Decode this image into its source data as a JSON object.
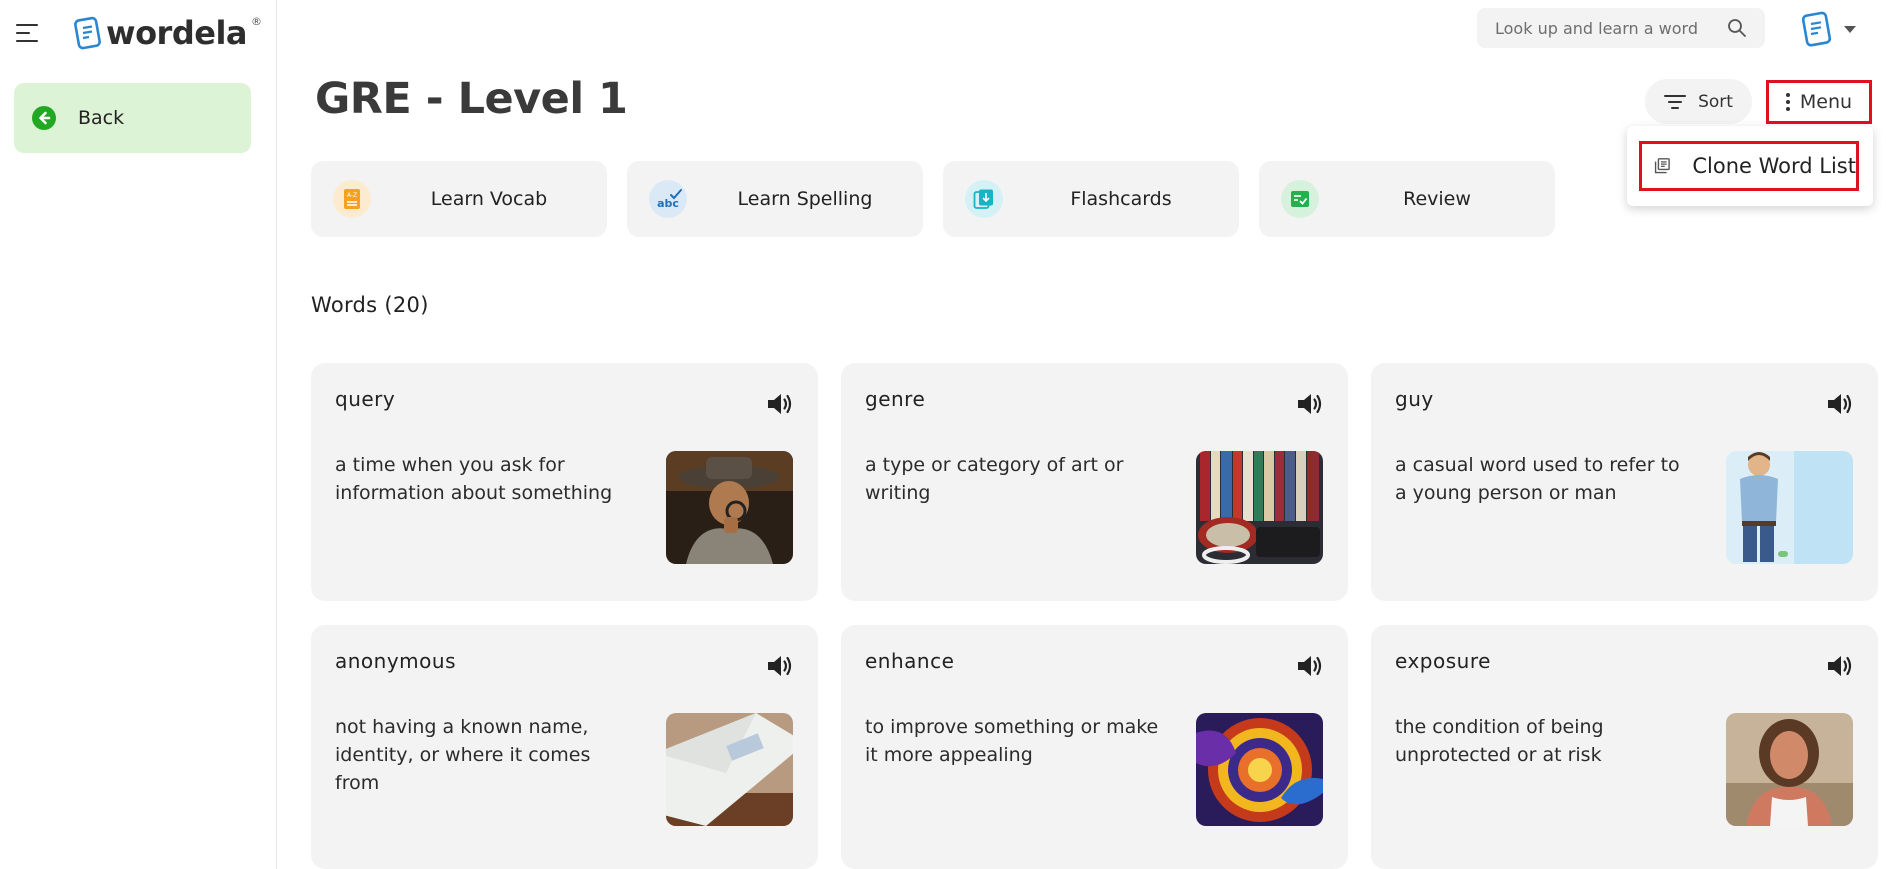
{
  "app": {
    "brand": "wordela",
    "brand_mark": "®"
  },
  "sidebar": {
    "back_label": "Back"
  },
  "search": {
    "placeholder": "Look up and learn a word"
  },
  "page": {
    "title": "GRE - Level 1",
    "sort_label": "Sort",
    "menu_label": "Menu"
  },
  "menu_dropdown": {
    "items": [
      {
        "label": "Clone Word List",
        "icon": "library-books-icon"
      }
    ]
  },
  "activities": [
    {
      "label": "Learn Vocab",
      "icon": "vocab-book-icon",
      "color": "#f6a21a"
    },
    {
      "label": "Learn Spelling",
      "icon": "abc-spelling-icon",
      "color": "#2a86d1"
    },
    {
      "label": "Flashcards",
      "icon": "flashcards-icon",
      "color": "#17b4c4"
    },
    {
      "label": "Review",
      "icon": "review-checklist-icon",
      "color": "#22b14c"
    }
  ],
  "words": {
    "heading": "Words (20)",
    "items": [
      {
        "word": "query",
        "definition": "a time when you ask for information about something",
        "image": "detective-with-magnifier-image"
      },
      {
        "word": "genre",
        "definition": "a type or category of art or writing",
        "image": "books-and-records-image"
      },
      {
        "word": "guy",
        "definition": "a casual word used to refer to a young person or man",
        "image": "young-man-cartoon-image"
      },
      {
        "word": "anonymous",
        "definition": "not having a known name, identity, or where it comes from",
        "image": "envelope-image"
      },
      {
        "word": "enhance",
        "definition": "to improve something or make it more appealing",
        "image": "colorful-swirl-art-image"
      },
      {
        "word": "exposure",
        "definition": "the condition of being unprotected or at risk",
        "image": "sunburned-woman-image"
      }
    ]
  },
  "colors": {
    "highlight": "#e0101f",
    "back_bg": "#dcf3d5",
    "back_icon": "#22a822",
    "card_bg": "#f3f3f3",
    "brand_blue": "#2a86d1"
  }
}
